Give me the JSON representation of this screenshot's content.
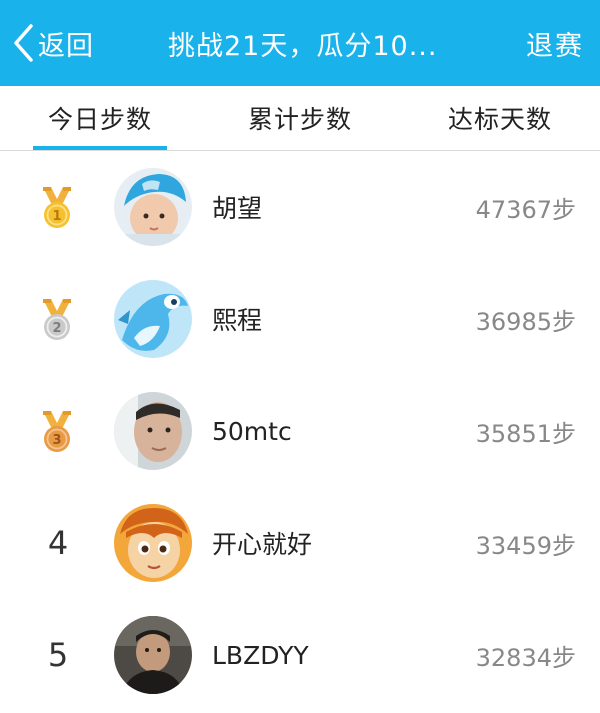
{
  "header": {
    "back_label": "返回",
    "title": "挑战21天，瓜分10...",
    "quit_label": "退赛",
    "accent_color": "#1ab2eb"
  },
  "tabs": [
    {
      "label": "今日步数",
      "active": true
    },
    {
      "label": "累计步数",
      "active": false
    },
    {
      "label": "达标天数",
      "active": false
    }
  ],
  "ranking": [
    {
      "rank": "1",
      "badge": "gold-medal-icon",
      "name": "胡望",
      "steps": "47367步"
    },
    {
      "rank": "2",
      "badge": "silver-medal-icon",
      "name": "熙程",
      "steps": "36985步"
    },
    {
      "rank": "3",
      "badge": "bronze-medal-icon",
      "name": "50mtc",
      "steps": "35851步"
    },
    {
      "rank": "4",
      "badge": "",
      "name": "开心就好",
      "steps": "33459步"
    },
    {
      "rank": "5",
      "badge": "",
      "name": "LBZDYY",
      "steps": "32834步"
    }
  ]
}
